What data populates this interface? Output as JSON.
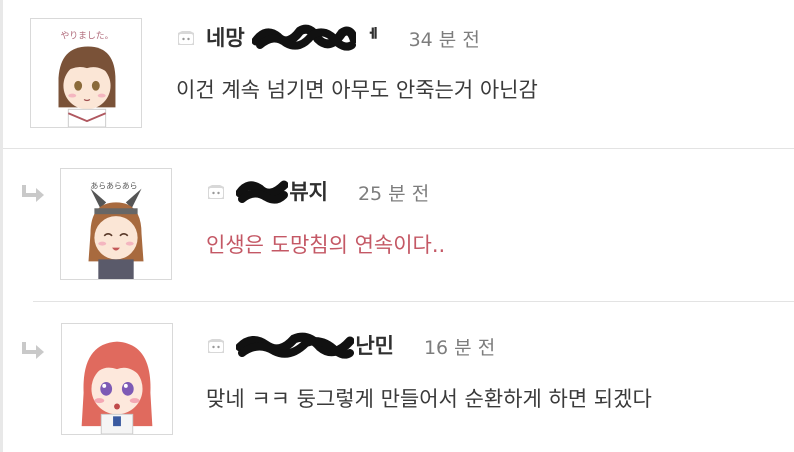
{
  "comments": [
    {
      "username_visible": "네망",
      "username_suffix": "ᅦ",
      "time": "34 분 전",
      "text": "이건 계속 넘기면 아무도 안죽는거 아닌감",
      "avatar_caption": "やりました。"
    },
    {
      "username_visible": "뷰지",
      "time": "25 분 전",
      "text": "인생은 도망침의 연속이다..",
      "avatar_caption": "あらあらあら"
    },
    {
      "username_visible": "난민",
      "time": "16 분 전",
      "text": "맞네 ㅋㅋ 둥그렇게 만들어서 순환하게 하면 되겠다"
    }
  ],
  "colors": {
    "accent_text": "#c45865",
    "time_gray": "#7d7d7d",
    "icon_pink": "#e7a6b3",
    "divider": "#e3e3e3"
  },
  "icons": {
    "user_badge": "cat-face-icon",
    "reply": "reply-arrow-icon"
  }
}
